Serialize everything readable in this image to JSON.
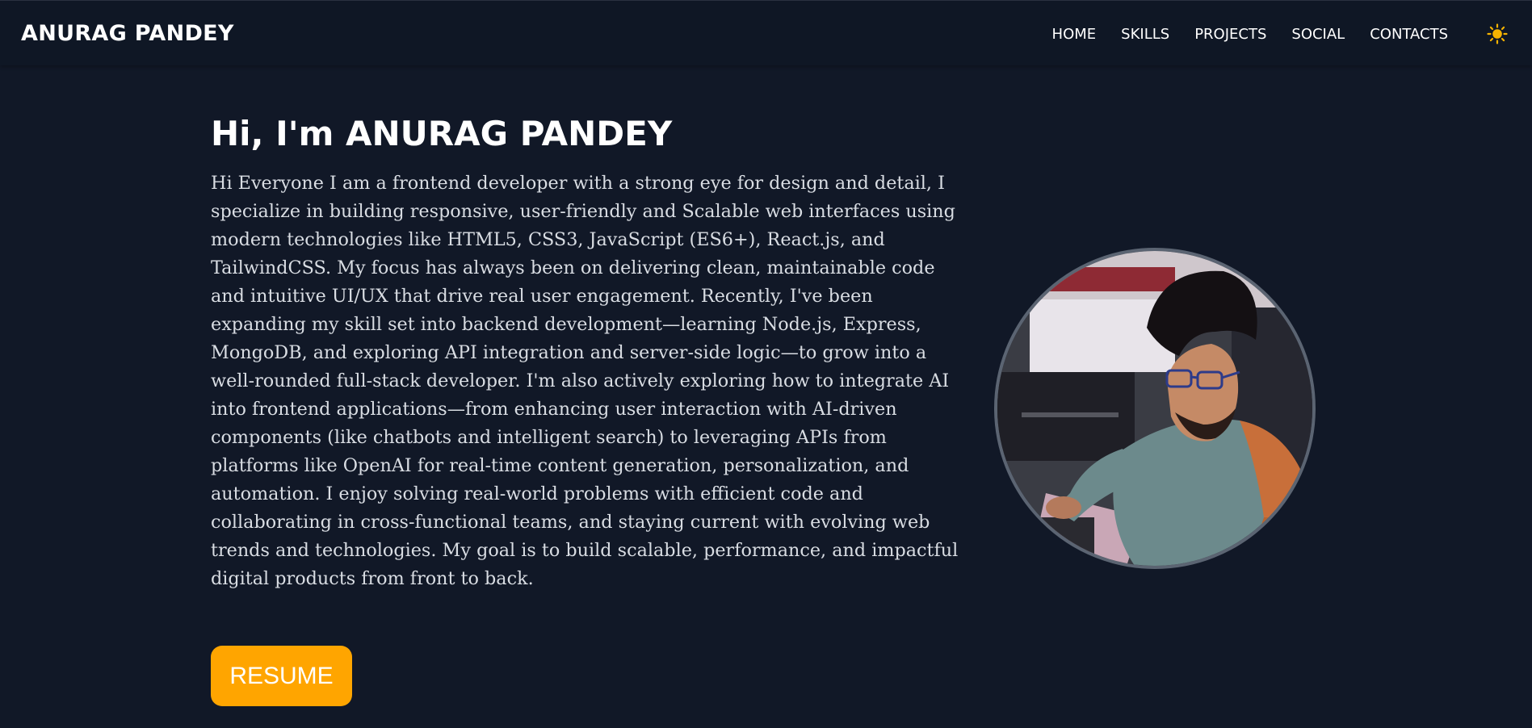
{
  "header": {
    "brand": "ANURAG PANDEY",
    "nav": [
      {
        "label": "HOME"
      },
      {
        "label": "SKILLS"
      },
      {
        "label": "PROJECTS"
      },
      {
        "label": "SOCIAL"
      },
      {
        "label": "CONTACTS"
      }
    ],
    "theme_icon": "sun-icon"
  },
  "hero": {
    "title": "Hi, I'm ANURAG PANDEY",
    "bio": "Hi Everyone I am a frontend developer with a strong eye for design and detail, I specialize in building responsive, user-friendly and Scalable web interfaces using modern technologies like HTML5, CSS3, JavaScript (ES6+), React.js, and TailwindCSS. My focus has always been on delivering clean, maintainable code and intuitive UI/UX that drive real user engagement. Recently, I've been expanding my skill set into backend development—learning Node.js, Express, MongoDB, and exploring API integration and server-side logic—to grow into a well-rounded full-stack developer. I'm also actively exploring how to integrate AI into frontend applications—from enhancing user interaction with AI-driven components (like chatbots and intelligent search) to leveraging APIs from platforms like OpenAI for real-time content generation, personalization, and automation. I enjoy solving real-world problems with efficient code and collaborating in cross-functional teams, and staying current with evolving web trends and technologies. My goal is to build scalable, performance, and impactful digital products from front to back.",
    "resume_label": "RESUME"
  },
  "colors": {
    "background": "#111827",
    "navbar": "#0f1725",
    "accent": "#ffa500",
    "sun": "#f5b301"
  }
}
